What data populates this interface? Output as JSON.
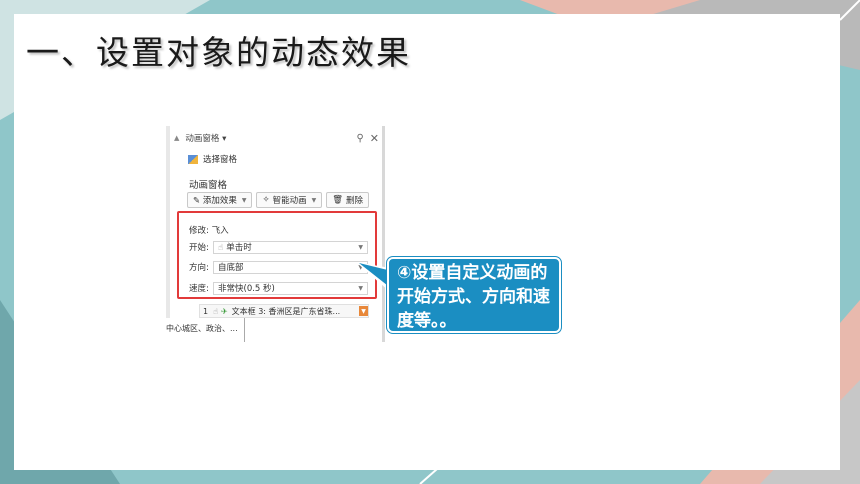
{
  "slide": {
    "title": "一、设置对象的动态效果"
  },
  "pane": {
    "header_title": "动画窗格 ▾",
    "pin_icon": "pin-icon",
    "close_icon": "close-icon",
    "select_pane_label": "选择窗格",
    "section_title": "动画窗格",
    "buttons": {
      "add_effect": "✎ 添加效果",
      "smart_animation": "智能动画",
      "delete": "删除"
    },
    "modify_label": "修改: 飞入",
    "start_label": "开始:",
    "start_value": "单击时",
    "direction_label": "方向:",
    "direction_value": "自底部",
    "speed_label": "速度:",
    "speed_value": "非常快(0.5 秒)",
    "list_item_number": "1",
    "list_item_text": "文本框 3: 香洲区是广东省珠...",
    "bottom_text": "中心城区、政治、..."
  },
  "callout": {
    "text": "④设置自定义动画的开始方式、方向和速度等。。"
  },
  "colors": {
    "background_teal": "#8fc6c9",
    "callout_blue": "#1b8ec2",
    "highlight_red": "#e23a3a"
  }
}
